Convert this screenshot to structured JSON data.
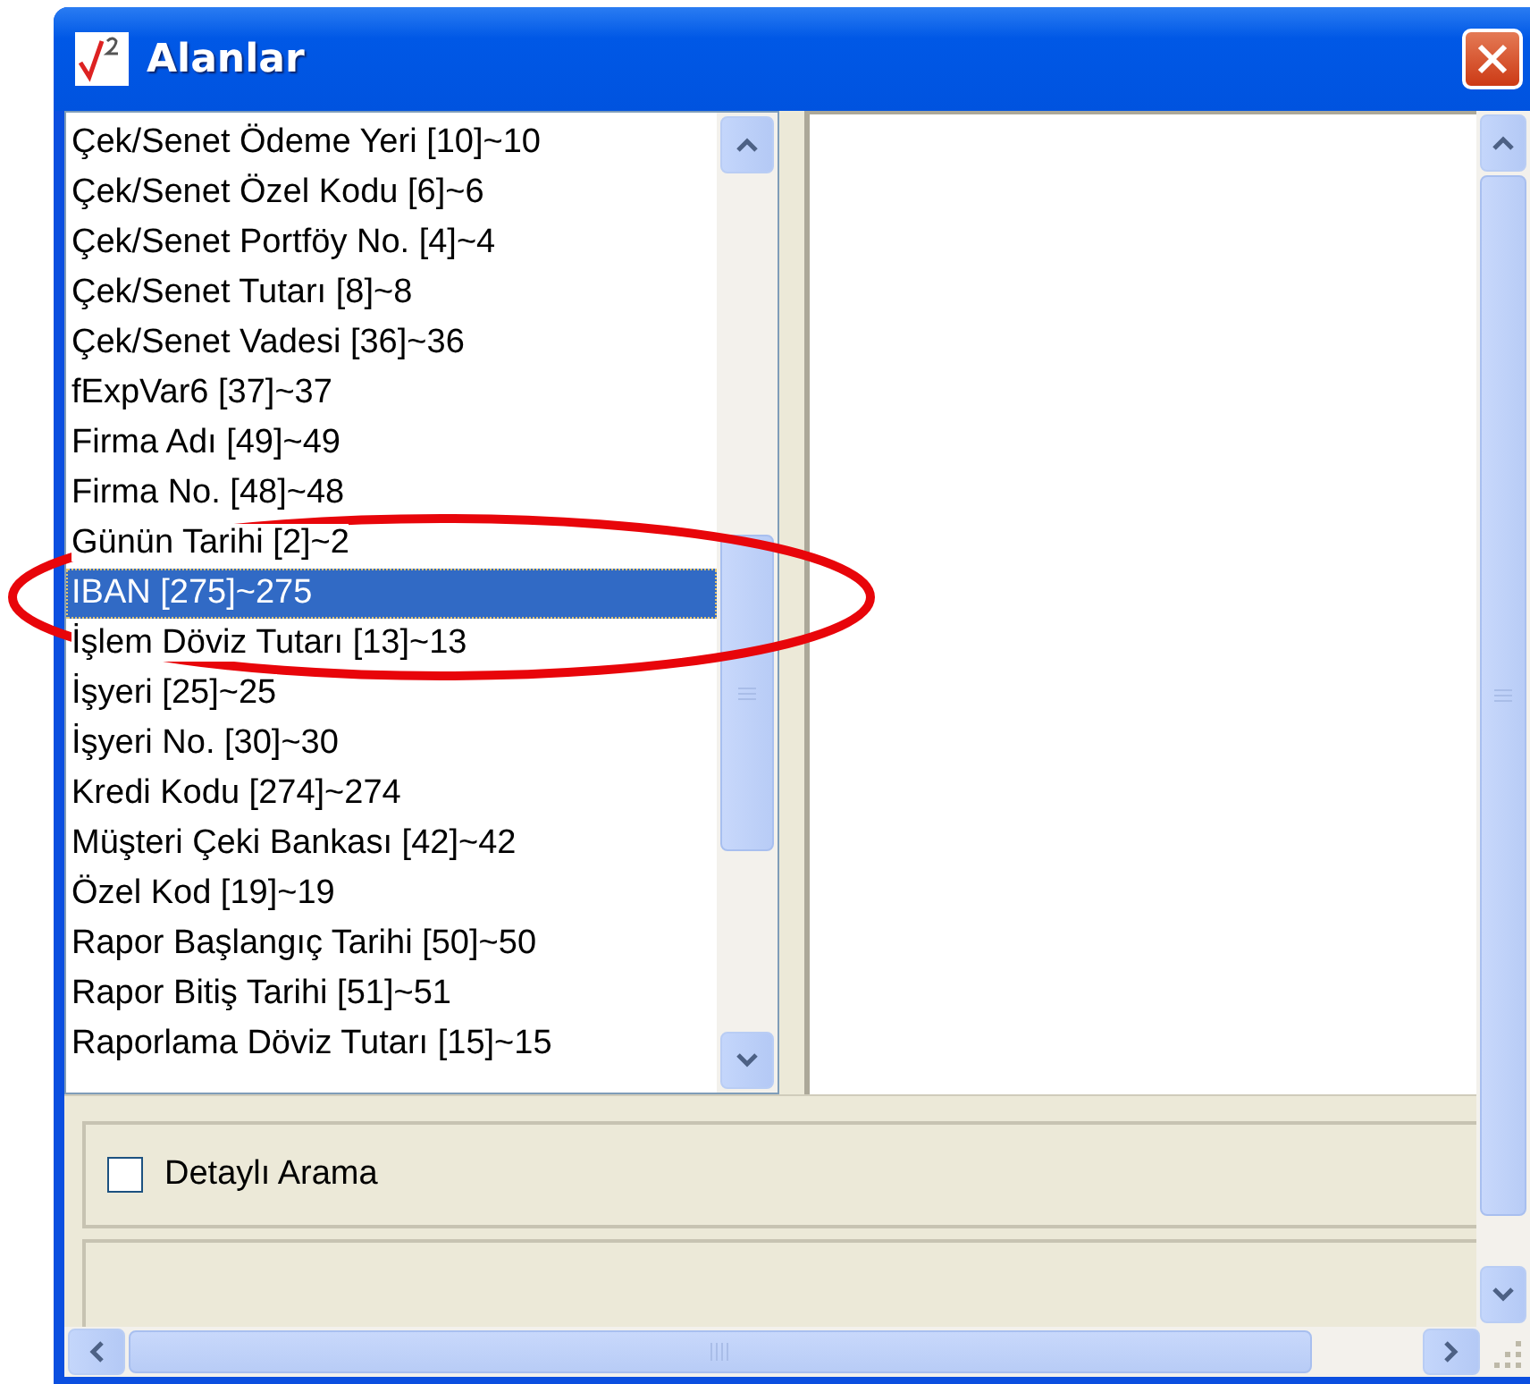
{
  "window": {
    "title": "Alanlar"
  },
  "fields": [
    {
      "label": "Çek/Senet Ödeme Yeri [10]~10",
      "selected": false
    },
    {
      "label": "Çek/Senet Özel Kodu [6]~6",
      "selected": false
    },
    {
      "label": "Çek/Senet Portföy No. [4]~4",
      "selected": false
    },
    {
      "label": "Çek/Senet Tutarı [8]~8",
      "selected": false
    },
    {
      "label": "Çek/Senet Vadesi [36]~36",
      "selected": false
    },
    {
      "label": "fExpVar6 [37]~37",
      "selected": false
    },
    {
      "label": "Firma Adı [49]~49",
      "selected": false
    },
    {
      "label": "Firma No. [48]~48",
      "selected": false
    },
    {
      "label": "Günün Tarihi [2]~2",
      "selected": false
    },
    {
      "label": "IBAN [275]~275",
      "selected": true
    },
    {
      "label": "İşlem Döviz Tutarı [13]~13",
      "selected": false
    },
    {
      "label": "İşyeri [25]~25",
      "selected": false
    },
    {
      "label": "İşyeri No. [30]~30",
      "selected": false
    },
    {
      "label": "Kredi Kodu [274]~274",
      "selected": false
    },
    {
      "label": "Müşteri Çeki Bankası [42]~42",
      "selected": false
    },
    {
      "label": "Özel Kod [19]~19",
      "selected": false
    },
    {
      "label": "Rapor Başlangıç Tarihi [50]~50",
      "selected": false
    },
    {
      "label": "Rapor Bitiş Tarihi [51]~51",
      "selected": false
    },
    {
      "label": "Raporlama Döviz Tutarı [15]~15",
      "selected": false
    }
  ],
  "detailed_search": {
    "label": "Detaylı Arama",
    "checked": false
  }
}
